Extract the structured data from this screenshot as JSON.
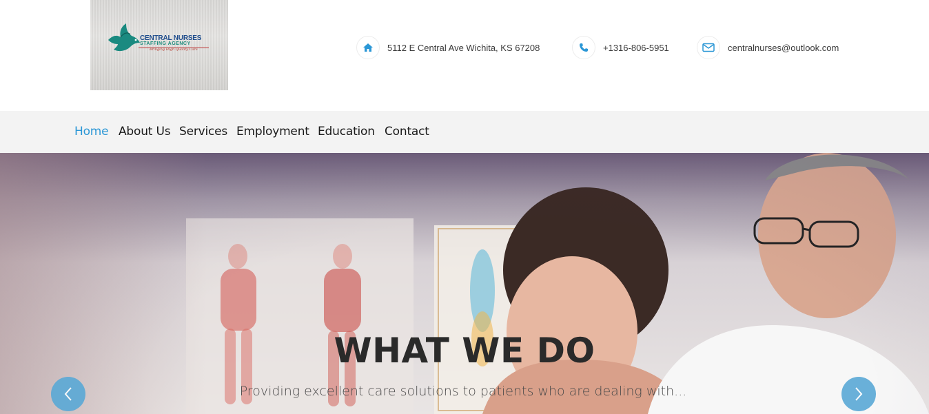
{
  "header": {
    "logo": {
      "line1": "CENTRAL NURSES",
      "line2": "STAFFING AGENCY",
      "line3": "Bringing High Quality Care"
    },
    "contacts": [
      {
        "icon": "home-icon",
        "text": "5112 E Central Ave Wichita, KS 67208"
      },
      {
        "icon": "phone-icon",
        "text": "+1316-806-5951"
      },
      {
        "icon": "envelope-icon",
        "text": "centralnurses@outlook.com"
      }
    ]
  },
  "nav": {
    "items": [
      {
        "label": "Home",
        "active": true
      },
      {
        "label": "About Us"
      },
      {
        "label": "Services"
      },
      {
        "label": "Employment"
      },
      {
        "label": "Education"
      },
      {
        "label": "Contact"
      }
    ]
  },
  "hero": {
    "title": "WHAT WE DO",
    "subtitle": "Providing excellent care solutions to patients who are dealing with..."
  },
  "colors": {
    "accent": "#2b97d6",
    "arrow": "#5aa9d6",
    "nav_bg": "#f3f3f3",
    "text_dark": "#1a1a1a"
  }
}
